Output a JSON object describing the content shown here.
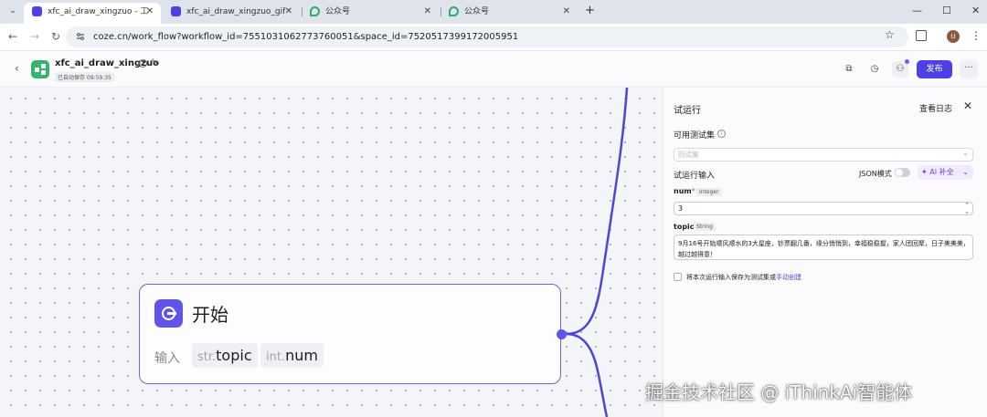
{
  "browser": {
    "tabs": [
      {
        "title": "xfc_ai_draw_xingzuo - 工作流",
        "active": true,
        "favicon": "coze-icon"
      },
      {
        "title": "xfc_ai_draw_xingzuo_gif - 工作",
        "active": false,
        "favicon": "coze-icon"
      },
      {
        "title": "公众号",
        "active": false,
        "favicon": "wechat-icon"
      },
      {
        "title": "公众号",
        "active": false,
        "favicon": "wechat-icon"
      }
    ],
    "url": "coze.cn/work_flow?workflow_id=7551031062773760051&space_id=7520517399172005951",
    "profile_initial": "U"
  },
  "app": {
    "title": "xfc_ai_draw_xingzuo",
    "autosave": "已自动保存 09:59:35",
    "publish_label": "发布"
  },
  "node": {
    "title": "开始",
    "input_label": "输入",
    "params": [
      {
        "type": "str.",
        "name": "topic"
      },
      {
        "type": "int.",
        "name": "num"
      }
    ]
  },
  "panel": {
    "title": "试运行",
    "view_log": "查看日志",
    "testset_label": "可用测试集",
    "testset_placeholder": "测试集",
    "run_input_label": "试运行输入",
    "json_mode_label": "JSON模式",
    "ai_fill_label": "AI 补全",
    "num_field": {
      "name": "num",
      "required_mark": "*",
      "type": "Integer",
      "value": "3"
    },
    "topic_field": {
      "name": "topic",
      "type": "String",
      "value": "9月16号开始顺风顺水的3大星座，钞票翻几番，缘分悄悄到，幸福稳稳握，家人团回聚，日子美美美，越过越得意！"
    },
    "save_text": "将本次运行输入保存为测试集或",
    "save_link": "手动创建"
  },
  "watermark": "掘金技术社区 @ iThinkAi智能体",
  "colors": {
    "accent": "#4e40e5",
    "node_border": "#6b63e8",
    "wire": "#4e45d6"
  }
}
